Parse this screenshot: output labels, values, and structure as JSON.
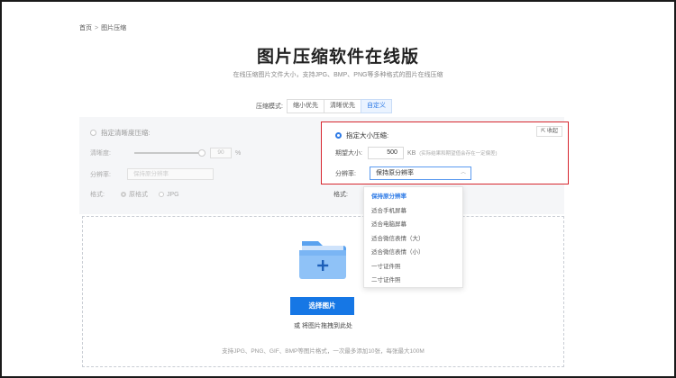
{
  "breadcrumb": {
    "home": "首页",
    "separator": ">",
    "current": "图片压缩"
  },
  "page": {
    "title": "图片压缩软件在线版",
    "subtitle": "在线压缩图片文件大小，支持JPG、BMP、PNG等多种格式的图片在线压缩"
  },
  "mode": {
    "label": "压缩模式:",
    "options": [
      "缩小优先",
      "清晰优先",
      "自定义"
    ],
    "selected": "自定义"
  },
  "left_option": {
    "label": "指定清晰度压缩:",
    "clarity_label": "清晰度:",
    "clarity_value": "90",
    "clarity_unit": "%",
    "resolution_label": "分辨率:",
    "resolution_value": "保持原分辨率",
    "format_label": "格式:",
    "format_options": [
      "原格式",
      "JPG"
    ],
    "format_selected": "原格式"
  },
  "right_option": {
    "label": "指定大小压缩:",
    "collapse_label": "收起",
    "size_label": "期望大小:",
    "size_value": "500",
    "size_unit": "KB",
    "size_hint": "(实际结果和期望值会存在一定偏差)",
    "resolution_label": "分辨率:",
    "resolution_value": "保持原分辨率",
    "format_label": "格式:"
  },
  "resolution_dropdown": {
    "options": [
      "保持原分辨率",
      "适合手机屏幕",
      "适合电脑屏幕",
      "适合微信表情（大）",
      "适合微信表情（小）",
      "一寸证件照",
      "二寸证件照"
    ],
    "selected_index": 0
  },
  "upload": {
    "button_label": "选择图片",
    "drag_hint": "或 将图片拖拽到此处",
    "support_hint": "支持JPG、PNG、GIF、BMP等图片格式，一次最多添加10张，每张最大100M"
  },
  "colors": {
    "accent": "#1677e5",
    "highlight_border": "#d7262e"
  }
}
